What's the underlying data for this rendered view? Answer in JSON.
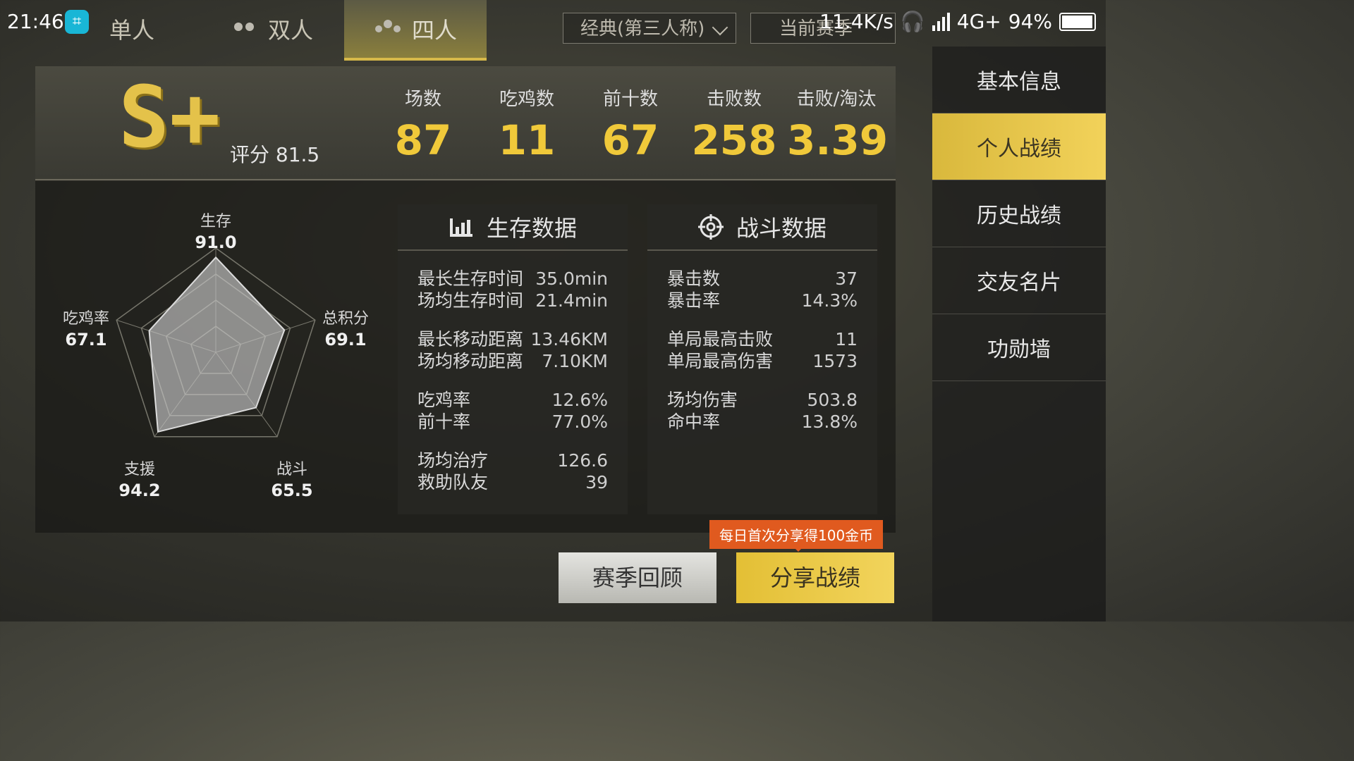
{
  "status_bar": {
    "time": "21:46",
    "speed": "11.4K/s",
    "network": "4G+",
    "battery": "94%"
  },
  "top_tabs": [
    {
      "label": "单人"
    },
    {
      "label": "双人"
    },
    {
      "label": "四人"
    }
  ],
  "mode_select": {
    "value": "经典(第三人称)"
  },
  "season_select": {
    "value": "当前赛季"
  },
  "sidebar": {
    "items": [
      {
        "label": "基本信息"
      },
      {
        "label": "个人战绩"
      },
      {
        "label": "历史战绩"
      },
      {
        "label": "交友名片"
      },
      {
        "label": "功勋墙"
      }
    ]
  },
  "header": {
    "rank": "S+",
    "score": "评分 81.5",
    "stats": [
      {
        "label": "场数",
        "value": "87"
      },
      {
        "label": "吃鸡数",
        "value": "11"
      },
      {
        "label": "前十数",
        "value": "67"
      },
      {
        "label": "击败数",
        "value": "258"
      },
      {
        "label": "击败/淘汰",
        "value": "3.39"
      }
    ]
  },
  "radar": {
    "axes": [
      {
        "label": "生存",
        "value": "91.0"
      },
      {
        "label": "总积分",
        "value": "69.1"
      },
      {
        "label": "战斗",
        "value": "65.5"
      },
      {
        "label": "支援",
        "value": "94.2"
      },
      {
        "label": "吃鸡率",
        "value": "67.1"
      }
    ]
  },
  "survival": {
    "title": "生存数据",
    "groups": [
      [
        {
          "label": "最长生存时间",
          "value": "35.0min"
        },
        {
          "label": "场均生存时间",
          "value": "21.4min"
        }
      ],
      [
        {
          "label": "最长移动距离",
          "value": "13.46KM"
        },
        {
          "label": "场均移动距离",
          "value": "7.10KM"
        }
      ],
      [
        {
          "label": "吃鸡率",
          "value": "12.6%"
        },
        {
          "label": "前十率",
          "value": "77.0%"
        }
      ],
      [
        {
          "label": "场均治疗",
          "value": "126.6"
        },
        {
          "label": "救助队友",
          "value": "39"
        }
      ]
    ]
  },
  "combat": {
    "title": "战斗数据",
    "groups": [
      [
        {
          "label": "暴击数",
          "value": "37"
        },
        {
          "label": "暴击率",
          "value": "14.3%"
        }
      ],
      [
        {
          "label": "单局最高击败",
          "value": "11"
        },
        {
          "label": "单局最高伤害",
          "value": "1573"
        }
      ],
      [
        {
          "label": "场均伤害",
          "value": "503.8"
        },
        {
          "label": "命中率",
          "value": "13.8%"
        }
      ]
    ]
  },
  "buttons": {
    "review": "赛季回顾",
    "share": "分享战绩",
    "promo": "每日首次分享得100金币"
  }
}
